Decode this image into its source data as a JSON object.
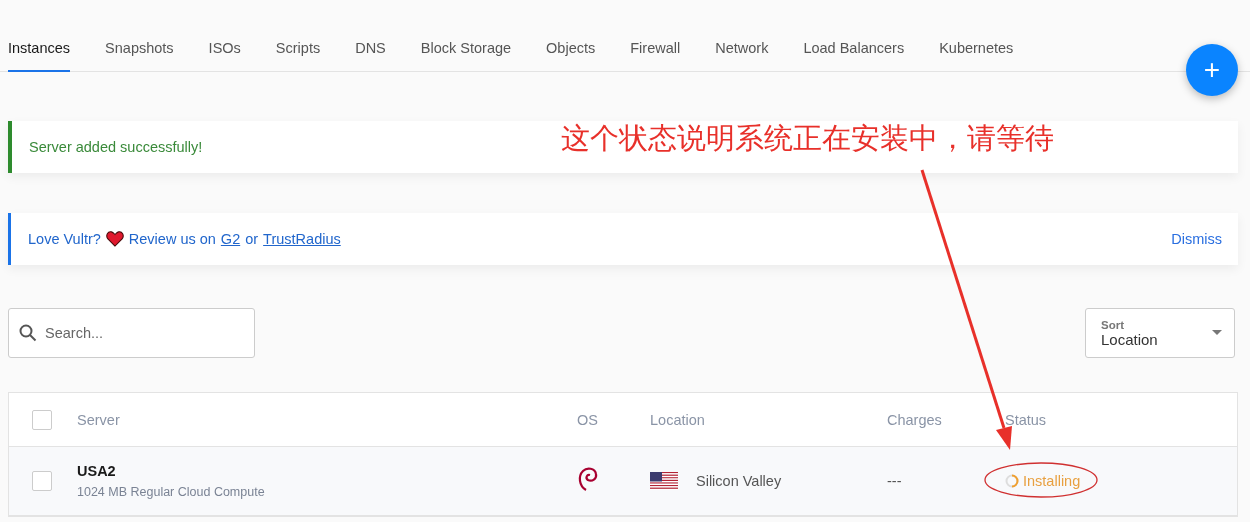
{
  "tabs": [
    {
      "label": "Instances",
      "selected": true
    },
    {
      "label": "Snapshots",
      "selected": false
    },
    {
      "label": "ISOs",
      "selected": false
    },
    {
      "label": "Scripts",
      "selected": false
    },
    {
      "label": "DNS",
      "selected": false
    },
    {
      "label": "Block Storage",
      "selected": false
    },
    {
      "label": "Objects",
      "selected": false
    },
    {
      "label": "Firewall",
      "selected": false
    },
    {
      "label": "Network",
      "selected": false
    },
    {
      "label": "Load Balancers",
      "selected": false
    },
    {
      "label": "Kubernetes",
      "selected": false
    }
  ],
  "add_button": {
    "label": "+"
  },
  "notices": [
    {
      "kind": "success",
      "text": "Server added successfully!"
    },
    {
      "kind": "review",
      "text": "Love Vultr?",
      "after_icon": "Review us on",
      "links": [
        "G2",
        "TrustRadius"
      ],
      "joiner": "or",
      "dismiss": "Dismiss"
    }
  ],
  "search": {
    "placeholder": "Search..."
  },
  "sort": {
    "label": "Sort",
    "value": "Location"
  },
  "table": {
    "select_all_checked": false,
    "columns": [
      "Server",
      "OS",
      "Location",
      "Charges",
      "Status"
    ],
    "rows": [
      {
        "name": "USA2",
        "plan": "1024 MB Regular Cloud Compute",
        "location": "Silicon Valley",
        "charges": "---",
        "status": "Installing",
        "checked": false
      }
    ]
  },
  "annotation": {
    "text": "这个状态说明系统正在安装中，请等待"
  }
}
